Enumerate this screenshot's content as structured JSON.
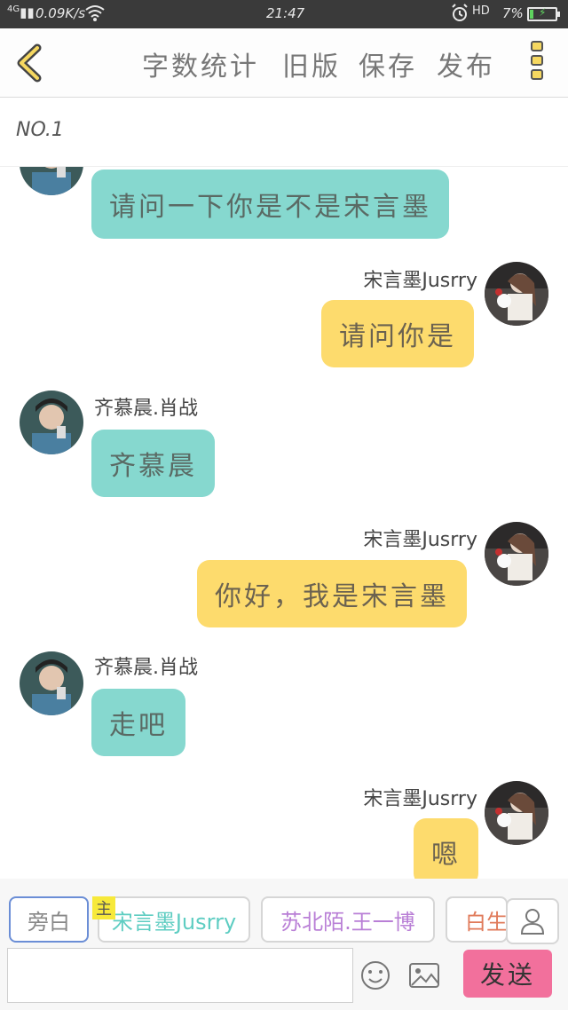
{
  "status_bar": {
    "signal": "4G",
    "net_speed": "0.09K/s",
    "time": "21:47",
    "hd": "HD",
    "battery": "7%"
  },
  "toolbar": {
    "word_count": "字数统计",
    "old_version": "旧版",
    "save": "保存",
    "publish": "发布"
  },
  "chapter": {
    "title": "NO.1"
  },
  "messages": [
    {
      "side": "left",
      "name": "",
      "text": "请问一下你是不是宋言墨"
    },
    {
      "side": "right",
      "name": "宋言墨Jusrry",
      "text": "请问你是"
    },
    {
      "side": "left",
      "name": "齐慕晨.肖战",
      "text": "齐慕晨"
    },
    {
      "side": "right",
      "name": "宋言墨Jusrry",
      "text": "你好，我是宋言墨"
    },
    {
      "side": "left",
      "name": "齐慕晨.肖战",
      "text": "走吧"
    },
    {
      "side": "right",
      "name": "宋言墨Jusrry",
      "text": "嗯"
    }
  ],
  "roles": [
    {
      "label": "旁白"
    },
    {
      "label": "宋言墨Jusrry",
      "badge": "主"
    },
    {
      "label": "苏北陌.王一博"
    },
    {
      "label": "白生"
    }
  ],
  "input": {
    "value": "",
    "placeholder": ""
  },
  "send_label": "发送",
  "colors": {
    "bubble_left": "#86d8cf",
    "bubble_right": "#fddb6d",
    "send": "#f2709c",
    "accent_yellow": "#f6d860"
  }
}
